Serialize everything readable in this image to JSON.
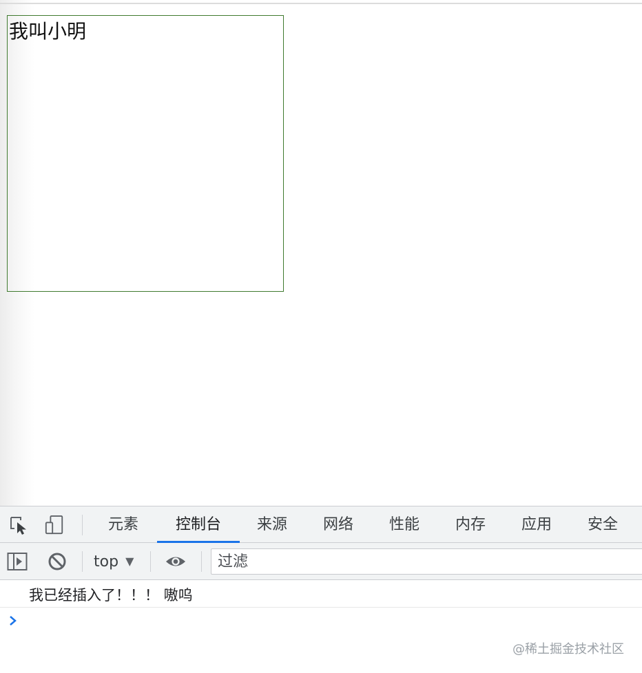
{
  "page": {
    "box_text": "我叫小明",
    "box_border_color": "#3f7a2e"
  },
  "devtools": {
    "toolbar_icons": [
      "inspect-element-icon",
      "device-toolbar-icon"
    ],
    "tabs": [
      {
        "label": "元素",
        "active": false
      },
      {
        "label": "控制台",
        "active": true
      },
      {
        "label": "来源",
        "active": false
      },
      {
        "label": "网络",
        "active": false
      },
      {
        "label": "性能",
        "active": false
      },
      {
        "label": "内存",
        "active": false
      },
      {
        "label": "应用",
        "active": false
      },
      {
        "label": "安全",
        "active": false
      }
    ],
    "accent_color": "#1a73e8",
    "console_toolbar": {
      "icons": [
        "sidebar-toggle-icon",
        "clear-console-icon",
        "live-expression-eye-icon"
      ],
      "context": "top",
      "filter_placeholder": "过滤"
    },
    "messages": [
      {
        "text": "我已经插入了！！！ 嗷呜"
      }
    ],
    "prompt_icon": "chevron-right-icon"
  },
  "watermark": "@稀土掘金技术社区"
}
